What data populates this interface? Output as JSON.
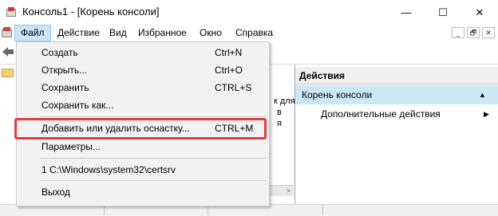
{
  "window": {
    "title": "Консоль1 - [Корень консоли]",
    "minimize_glyph": "—",
    "maximize_glyph": "☐",
    "close_glyph": "✕"
  },
  "menubar": {
    "items": [
      {
        "label": "Файл"
      },
      {
        "label": "Действие"
      },
      {
        "label": "Вид"
      },
      {
        "label": "Избранное"
      },
      {
        "label": "Окно"
      },
      {
        "label": "Справка"
      }
    ],
    "mdi": {
      "minimize": "_",
      "restore": "🗗",
      "close": "✕"
    }
  },
  "file_menu": {
    "items": [
      {
        "label": "Создать",
        "shortcut": "Ctrl+N"
      },
      {
        "label": "Открыть...",
        "shortcut": "Ctrl+O"
      },
      {
        "label": "Сохранить",
        "shortcut": "CTRL+S"
      },
      {
        "label": "Сохранить как...",
        "shortcut": ""
      },
      {
        "label": "Добавить или удалить оснастку...",
        "shortcut": "CTRL+M"
      },
      {
        "label": "Параметры...",
        "shortcut": ""
      },
      {
        "label": "1 C:\\Windows\\system32\\certsrv",
        "shortcut": ""
      },
      {
        "label": "Выход",
        "shortcut": ""
      }
    ]
  },
  "center": {
    "fragments": [
      "к для",
      "в",
      "я"
    ],
    "scroll_arrow": ">"
  },
  "actions": {
    "header": "Действия",
    "root_label": "Корень консоли",
    "root_arrow": "▲",
    "more_label": "Дополнительные действия",
    "more_arrow": "▶"
  },
  "colors": {
    "highlight_border": "#e03e3e",
    "selected_menu_bg": "#cce4f7",
    "actions_selected_bg": "#cce8f4"
  }
}
